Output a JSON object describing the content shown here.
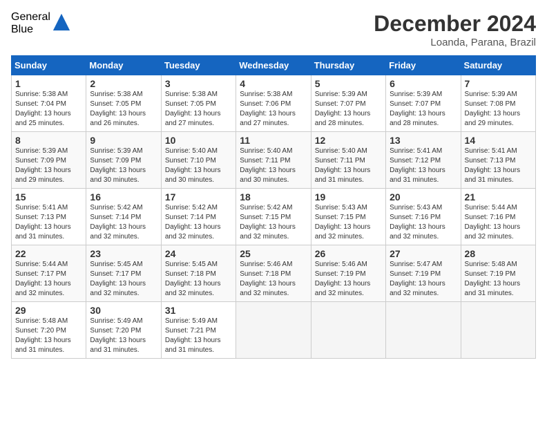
{
  "logo": {
    "general": "General",
    "blue": "Blue"
  },
  "title": "December 2024",
  "location": "Loanda, Parana, Brazil",
  "days_of_week": [
    "Sunday",
    "Monday",
    "Tuesday",
    "Wednesday",
    "Thursday",
    "Friday",
    "Saturday"
  ],
  "weeks": [
    [
      {
        "day": "1",
        "sunrise": "5:38 AM",
        "sunset": "7:04 PM",
        "daylight": "13 hours and 25 minutes."
      },
      {
        "day": "2",
        "sunrise": "5:38 AM",
        "sunset": "7:05 PM",
        "daylight": "13 hours and 26 minutes."
      },
      {
        "day": "3",
        "sunrise": "5:38 AM",
        "sunset": "7:05 PM",
        "daylight": "13 hours and 27 minutes."
      },
      {
        "day": "4",
        "sunrise": "5:38 AM",
        "sunset": "7:06 PM",
        "daylight": "13 hours and 27 minutes."
      },
      {
        "day": "5",
        "sunrise": "5:39 AM",
        "sunset": "7:07 PM",
        "daylight": "13 hours and 28 minutes."
      },
      {
        "day": "6",
        "sunrise": "5:39 AM",
        "sunset": "7:07 PM",
        "daylight": "13 hours and 28 minutes."
      },
      {
        "day": "7",
        "sunrise": "5:39 AM",
        "sunset": "7:08 PM",
        "daylight": "13 hours and 29 minutes."
      }
    ],
    [
      {
        "day": "8",
        "sunrise": "5:39 AM",
        "sunset": "7:09 PM",
        "daylight": "13 hours and 29 minutes."
      },
      {
        "day": "9",
        "sunrise": "5:39 AM",
        "sunset": "7:09 PM",
        "daylight": "13 hours and 30 minutes."
      },
      {
        "day": "10",
        "sunrise": "5:40 AM",
        "sunset": "7:10 PM",
        "daylight": "13 hours and 30 minutes."
      },
      {
        "day": "11",
        "sunrise": "5:40 AM",
        "sunset": "7:11 PM",
        "daylight": "13 hours and 30 minutes."
      },
      {
        "day": "12",
        "sunrise": "5:40 AM",
        "sunset": "7:11 PM",
        "daylight": "13 hours and 31 minutes."
      },
      {
        "day": "13",
        "sunrise": "5:41 AM",
        "sunset": "7:12 PM",
        "daylight": "13 hours and 31 minutes."
      },
      {
        "day": "14",
        "sunrise": "5:41 AM",
        "sunset": "7:13 PM",
        "daylight": "13 hours and 31 minutes."
      }
    ],
    [
      {
        "day": "15",
        "sunrise": "5:41 AM",
        "sunset": "7:13 PM",
        "daylight": "13 hours and 31 minutes."
      },
      {
        "day": "16",
        "sunrise": "5:42 AM",
        "sunset": "7:14 PM",
        "daylight": "13 hours and 32 minutes."
      },
      {
        "day": "17",
        "sunrise": "5:42 AM",
        "sunset": "7:14 PM",
        "daylight": "13 hours and 32 minutes."
      },
      {
        "day": "18",
        "sunrise": "5:42 AM",
        "sunset": "7:15 PM",
        "daylight": "13 hours and 32 minutes."
      },
      {
        "day": "19",
        "sunrise": "5:43 AM",
        "sunset": "7:15 PM",
        "daylight": "13 hours and 32 minutes."
      },
      {
        "day": "20",
        "sunrise": "5:43 AM",
        "sunset": "7:16 PM",
        "daylight": "13 hours and 32 minutes."
      },
      {
        "day": "21",
        "sunrise": "5:44 AM",
        "sunset": "7:16 PM",
        "daylight": "13 hours and 32 minutes."
      }
    ],
    [
      {
        "day": "22",
        "sunrise": "5:44 AM",
        "sunset": "7:17 PM",
        "daylight": "13 hours and 32 minutes."
      },
      {
        "day": "23",
        "sunrise": "5:45 AM",
        "sunset": "7:17 PM",
        "daylight": "13 hours and 32 minutes."
      },
      {
        "day": "24",
        "sunrise": "5:45 AM",
        "sunset": "7:18 PM",
        "daylight": "13 hours and 32 minutes."
      },
      {
        "day": "25",
        "sunrise": "5:46 AM",
        "sunset": "7:18 PM",
        "daylight": "13 hours and 32 minutes."
      },
      {
        "day": "26",
        "sunrise": "5:46 AM",
        "sunset": "7:19 PM",
        "daylight": "13 hours and 32 minutes."
      },
      {
        "day": "27",
        "sunrise": "5:47 AM",
        "sunset": "7:19 PM",
        "daylight": "13 hours and 32 minutes."
      },
      {
        "day": "28",
        "sunrise": "5:48 AM",
        "sunset": "7:19 PM",
        "daylight": "13 hours and 31 minutes."
      }
    ],
    [
      {
        "day": "29",
        "sunrise": "5:48 AM",
        "sunset": "7:20 PM",
        "daylight": "13 hours and 31 minutes."
      },
      {
        "day": "30",
        "sunrise": "5:49 AM",
        "sunset": "7:20 PM",
        "daylight": "13 hours and 31 minutes."
      },
      {
        "day": "31",
        "sunrise": "5:49 AM",
        "sunset": "7:21 PM",
        "daylight": "13 hours and 31 minutes."
      },
      null,
      null,
      null,
      null
    ]
  ]
}
